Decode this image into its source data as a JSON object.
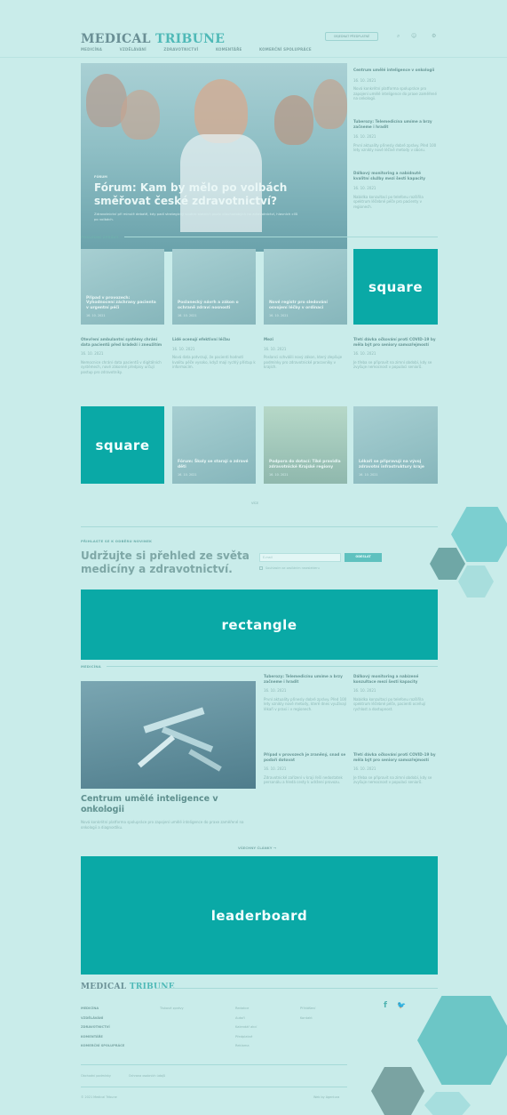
{
  "header": {
    "logo_a": "MEDICAL",
    "logo_b": "TRIBUNE",
    "subscribe_label": "OBJEDNAT PŘEDPLATNÉ",
    "nav": [
      "MEDICÍNA",
      "VZDĚLÁVÁNÍ",
      "ZDRAVOTNICTVÍ",
      "KOMENTÁŘE",
      "KOMERČNÍ SPOLUPRÁCE"
    ]
  },
  "hero": {
    "tag": "FÓRUM",
    "title": "Fórum: Kam by mělo po volbách směřovat české zdravotnictví?",
    "lead": "Zdravotnictví při minulé debatě, kdy padl strategický souhrn statních poziv dlouhodobých na zdravotnictví, hlavních cílů po volbách."
  },
  "side_articles": [
    {
      "title": "Centrum umělé inteligence v onkologii",
      "date": "16. 10. 2021",
      "text": "Nová konkrétní platforma spolupráce pro zapojení umělé inteligence do praxe zaměřené na onkologii."
    },
    {
      "title": "Tuberozy: Telemedicína umíme a brzy začneme i hradit",
      "date": "16. 10. 2021",
      "text": "První aktuality přinesly dobré zprávy. Před 100 lety vznikly nové léčivé metody v oboru."
    },
    {
      "title": "Dálkový monitoring a nabídnuté kvalitní služby mezi šesti kapacity",
      "date": "16. 10. 2021",
      "text": "Nabídka konzultací po telefonu rozšířila spektrum léčebné péče pro pacienty v regionech."
    }
  ],
  "top_section": {
    "label": "POSLEDNÍ ZPRÁVY",
    "thumbs": [
      {
        "caption": "Případ v provozech: Vyhodnocení záchrany pacienta v urgentní péči",
        "date": "16. 10. 2021"
      },
      {
        "caption": "Poslanecký návrh a zákon o ochraně zdraví nosnosti",
        "date": "16. 10. 2021"
      },
      {
        "caption": "Nové registr pro sledování osvojení léčby v ordinaci",
        "date": "16. 10. 2021"
      }
    ],
    "ad_label": "square",
    "articles": [
      {
        "title": "Otevření ambulantní systémy chrání data pacientů před krádeží i zneužitím",
        "date": "16. 10. 2021",
        "text": "Nemocnice chrání data pacientů v digitálních systémech, nové zákonné předpisy určují postup pro zdravotníky."
      },
      {
        "title": "Lidé ocenují efektivní léčbu",
        "date": "16. 10. 2021",
        "text": "Nová data potvrzují, že pacienti hodnotí kvalitu péče vysoko, když mají rychlý přístup k informacím."
      },
      {
        "title": "Mezi",
        "date": "16. 10. 2021",
        "text": "Poslanci schválili nový zákon, který zlepšuje podmínky pro zdravotnické pracovníky v krajích."
      },
      {
        "title": "Třetí dávka očkování proti COVID-19 by měla být pro seniory samozřejmostí",
        "date": "16. 10. 2021",
        "text": "Je třeba se připravit na zimní období, kdy se zvyšuje nemocnost v populaci seniorů."
      }
    ]
  },
  "second_row": {
    "ad_label": "square",
    "thumbs": [
      {
        "caption": "Fórum: Školy se starají o zdravé děti",
        "date": "16. 10. 2021"
      },
      {
        "caption": "Podpora do dotací: Tiké pravidla zdravotnické Krajské regiony",
        "date": "16. 10. 2021"
      },
      {
        "caption": "Lékaři se připravují na vývoj zdravotní infrastruktury kraje",
        "date": "16. 10. 2021"
      }
    ]
  },
  "more_link": "VÍCE",
  "newsletter": {
    "label": "PŘIHLASTE SE K ODBĚRU NOVINEK",
    "title": "Udržujte si přehled ze světa medicíny a zdravotnictví.",
    "input_placeholder": "E-mail",
    "button_label": "ODESLAT",
    "consent": "Souhlasím se zasíláním newsletteru"
  },
  "ad_rectangle": "rectangle",
  "medicina": {
    "label": "MEDICÍNA",
    "feature_title": "Centrum umělé inteligence v onkologii",
    "feature_date": "16. 10. 2021",
    "feature_text": "Nová konkrétní platforma spolupráce pro zapojení umělé inteligence do praxe zaměřené na onkologii a diagnostiku.",
    "articles": [
      {
        "title": "Tuberozy: Telemedicínu umíme a brzy začneme i hradit",
        "date": "16. 10. 2021",
        "text": "První aktuality přinesly dobré zprávy. Před 100 lety vznikly nové metody, které dnes využívají lékaři v praxi i v regionech."
      },
      {
        "title": "Dálkový monitoring a nabízené konzultace mezi šesti kapacity",
        "date": "16. 10. 2021",
        "text": "Nabídka konzultací po telefonu rozšířila spektrum léčebné péče, pacienti oceňují rychlost a dostupnost."
      },
      {
        "title": "Případ v provozech je zraněný, snad se podaří dotovat",
        "date": "16. 10. 2021",
        "text": "Zdravotnické zařízení v kraji řeší nedostatek personálu a hledá cesty k udržení provozu."
      },
      {
        "title": "Třetí dávka očkování proti COVID-19 by měla být pro seniory samozřejmostí",
        "date": "16. 10. 2021",
        "text": "Je třeba se připravit na zimní období, kdy se zvyšuje nemocnost v populaci seniorů."
      }
    ],
    "more": "VŠECHNY ČLÁNKY →"
  },
  "ad_leaderboard": "leaderboard",
  "footer": {
    "logo_a": "MEDICAL",
    "logo_b": "TRIBUNE",
    "col1": [
      "MEDICÍNA",
      "VZDĚLÁVÁNÍ",
      "ZDRAVOTNICTVÍ",
      "KOMENTÁŘE",
      "KOMERČNÍ SPOLUPRÁCE"
    ],
    "col2": [
      "Tiskové zprávy"
    ],
    "col3": [
      "Redakce",
      "Autoři",
      "Kalendář akcí",
      "Předplatné",
      "Reklama"
    ],
    "col4": [
      "Přihlášení",
      "Kontakt"
    ],
    "bottom_links": [
      "Obchodní podmínky",
      "Ochrana osobních údajů"
    ],
    "copyright": "© 2021 Medical Tribune",
    "credit": "Web by Agentura"
  }
}
